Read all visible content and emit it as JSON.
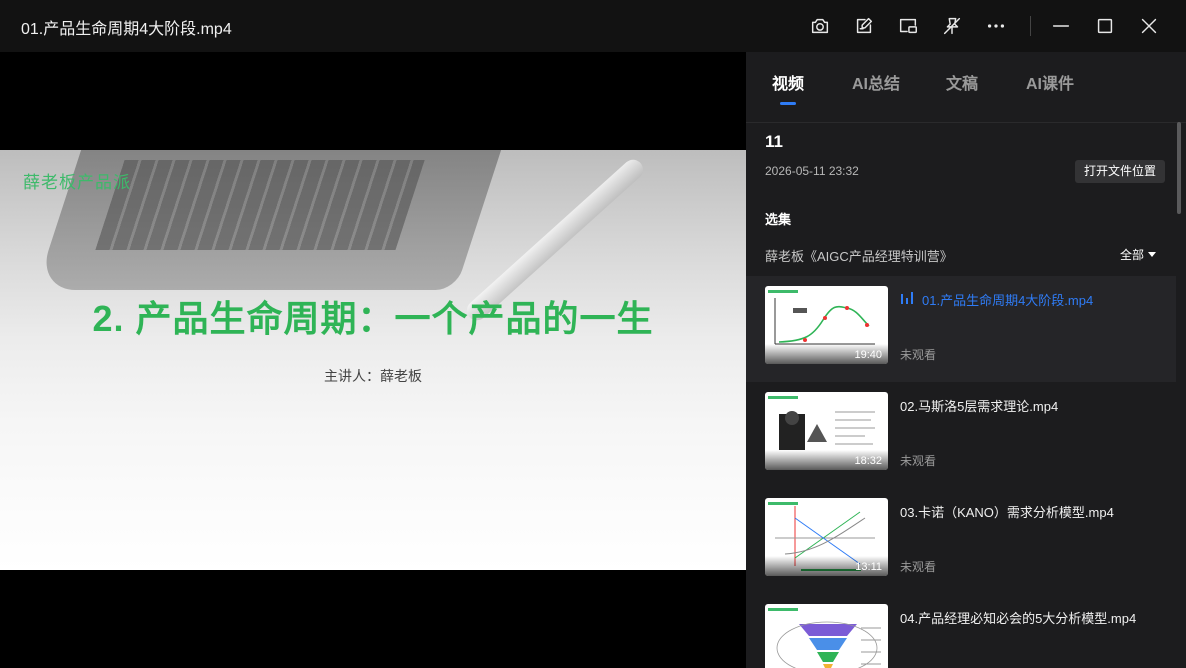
{
  "window": {
    "title": "01.产品生命周期4大阶段.mp4",
    "icons": [
      "screenshot-icon",
      "note-icon",
      "picture-in-picture-icon",
      "pin-off-icon",
      "more-icon",
      "minimize-icon",
      "maximize-icon",
      "close-icon"
    ]
  },
  "video": {
    "watermark": "薛老板产品派",
    "slide_title": "2. 产品生命周期：一个产品的一生",
    "slide_subtitle": "主讲人：薛老板"
  },
  "sidebar": {
    "tabs": [
      {
        "label": "视频",
        "active": true
      },
      {
        "label": "AI总结",
        "active": false
      },
      {
        "label": "文稿",
        "active": false
      },
      {
        "label": "AI课件",
        "active": false
      }
    ],
    "file": {
      "name": "11",
      "date": "2026-05-11 23:32",
      "open_button": "打开文件位置"
    },
    "selection_label": "选集",
    "series_name": "薛老板《AIGC产品经理特训营》",
    "filter_label": "全部",
    "items": [
      {
        "title": "01.产品生命周期4大阶段.mp4",
        "duration": "19:40",
        "status": "未观看",
        "active": true
      },
      {
        "title": "02.马斯洛5层需求理论.mp4",
        "duration": "18:32",
        "status": "未观看",
        "active": false
      },
      {
        "title": "03.卡诺（KANO）需求分析模型.mp4",
        "duration": "13:11",
        "status": "未观看",
        "active": false
      },
      {
        "title": "04.产品经理必知必会的5大分析模型.mp4",
        "duration": "",
        "status": "",
        "active": false
      }
    ]
  },
  "colors": {
    "accent": "#2f7cf6",
    "slide_green": "#2fb456",
    "sidebar_bg": "#1c1c1e"
  }
}
